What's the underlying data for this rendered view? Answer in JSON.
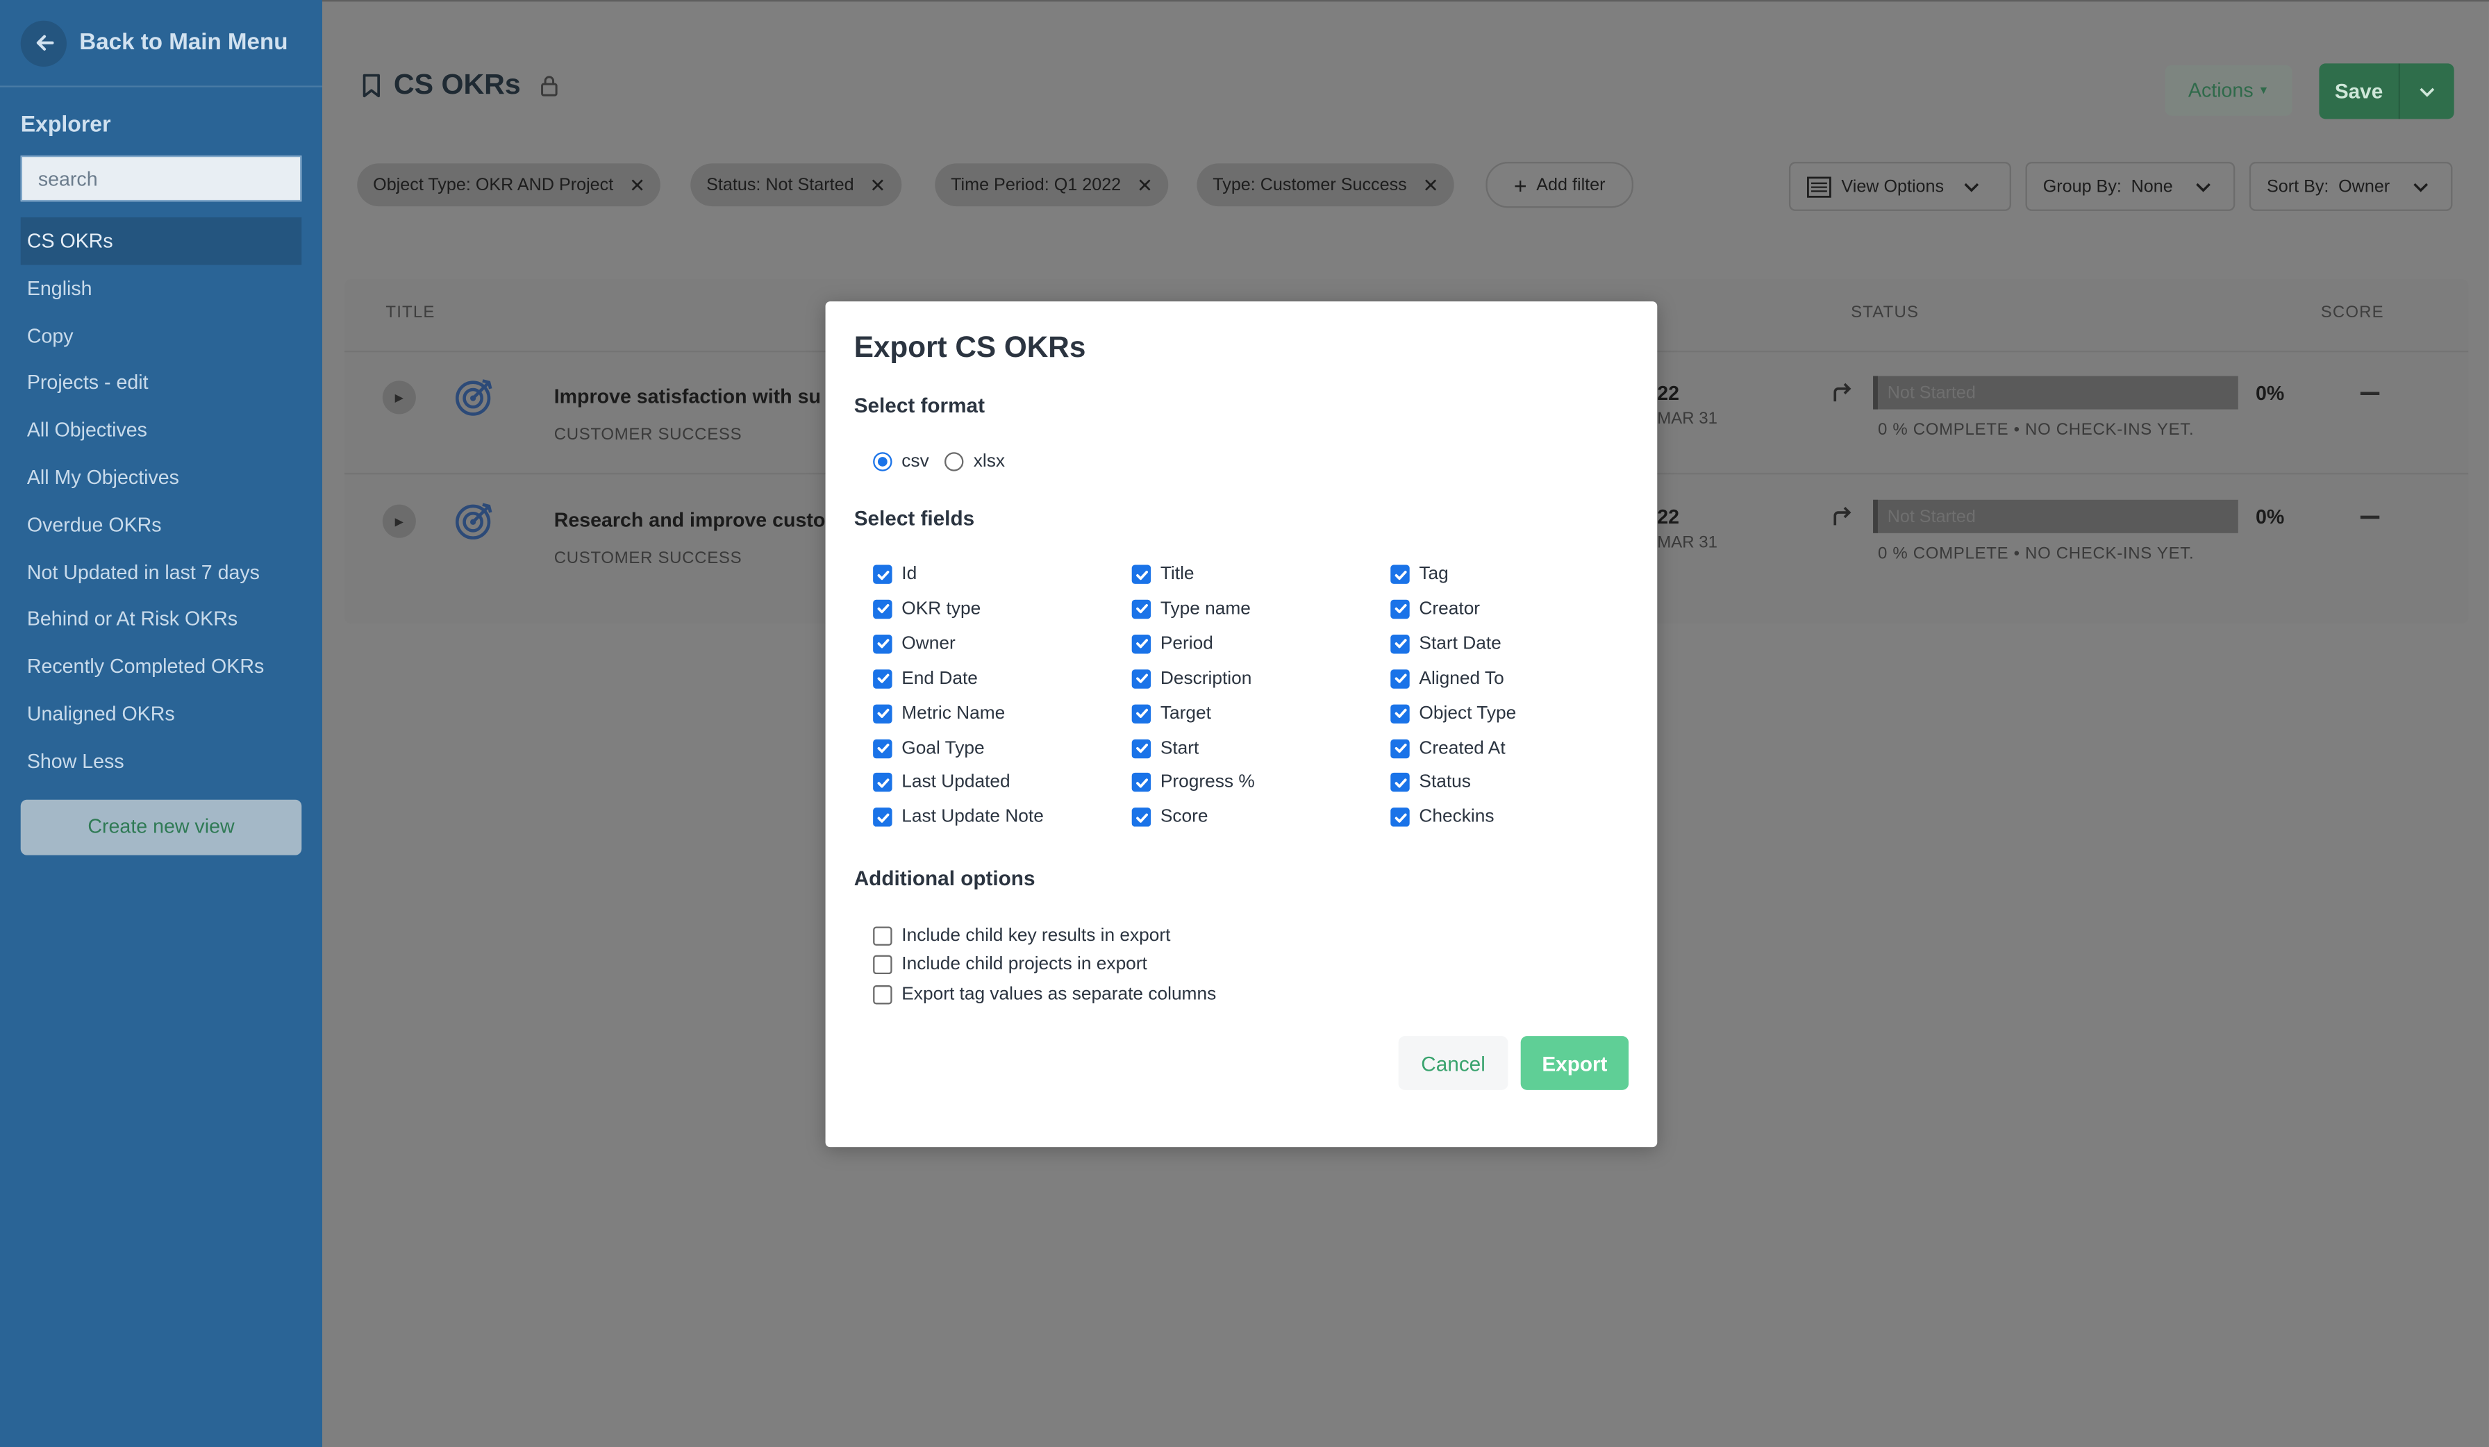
{
  "sidebar": {
    "back_label": "Back to Main Menu",
    "explorer_title": "Explorer",
    "search_placeholder": "search",
    "items": [
      {
        "label": "CS OKRs"
      },
      {
        "label": "English"
      },
      {
        "label": "Copy"
      },
      {
        "label": "Projects - edit"
      },
      {
        "label": "All Objectives"
      },
      {
        "label": "All My Objectives"
      },
      {
        "label": "Overdue OKRs"
      },
      {
        "label": "Not Updated in last 7 days"
      },
      {
        "label": "Behind or At Risk OKRs"
      },
      {
        "label": "Recently Completed OKRs"
      },
      {
        "label": "Unaligned OKRs"
      },
      {
        "label": "Show Less"
      }
    ],
    "create_view_label": "Create new view"
  },
  "header": {
    "title": "CS OKRs",
    "actions_label": "Actions",
    "save_label": "Save"
  },
  "filters": [
    {
      "label": "Object Type: OKR AND Project"
    },
    {
      "label": "Status: Not Started"
    },
    {
      "label": "Time Period: Q1 2022"
    },
    {
      "label": "Type: Customer Success"
    }
  ],
  "add_filter_label": "Add filter",
  "view_options_label": "View Options",
  "group_by": {
    "label": "Group By:",
    "value": "None"
  },
  "sort_by": {
    "label": "Sort By:",
    "value": "Owner"
  },
  "table": {
    "headers": {
      "title": "TITLE",
      "status": "STATUS",
      "score": "SCORE"
    },
    "rows": [
      {
        "title": "Improve satisfaction with su",
        "type": "CUSTOMER SUCCESS",
        "date_frag": "22",
        "date_sub": "MAR 31",
        "status": "Not Started",
        "pct": "0%",
        "status_sub": "0 % COMPLETE • NO CHECK-INS YET."
      },
      {
        "title": "Research and improve custo",
        "type": "CUSTOMER SUCCESS",
        "date_frag": "22",
        "date_sub": "MAR 31",
        "status": "Not Started",
        "pct": "0%",
        "status_sub": "0 % COMPLETE • NO CHECK-INS YET."
      }
    ]
  },
  "modal": {
    "title": "Export CS OKRs",
    "select_format_label": "Select format",
    "formats": [
      {
        "label": "csv",
        "selected": true
      },
      {
        "label": "xlsx",
        "selected": false
      }
    ],
    "select_fields_label": "Select fields",
    "fields": [
      [
        "Id",
        "Title",
        "Tag"
      ],
      [
        "OKR type",
        "Type name",
        "Creator"
      ],
      [
        "Owner",
        "Period",
        "Start Date"
      ],
      [
        "End Date",
        "Description",
        "Aligned To"
      ],
      [
        "Metric Name",
        "Target",
        "Object Type"
      ],
      [
        "Goal Type",
        "Start",
        "Created At"
      ],
      [
        "Last Updated",
        "Progress %",
        "Status"
      ],
      [
        "Last Update Note",
        "Score",
        "Checkins"
      ]
    ],
    "additional_options_label": "Additional options",
    "options": [
      {
        "label": "Include child key results in export",
        "checked": false
      },
      {
        "label": "Include child projects in export",
        "checked": false
      },
      {
        "label": "Export tag values as separate columns",
        "checked": false
      }
    ],
    "cancel_label": "Cancel",
    "export_label": "Export"
  },
  "colors": {
    "sidebar_bg": "#2a6496",
    "overlay_bg": "#7f7f7f",
    "accent_blue": "#1a73e8",
    "export_green": "#5fcf96",
    "save_green": "#2f6e4b"
  }
}
